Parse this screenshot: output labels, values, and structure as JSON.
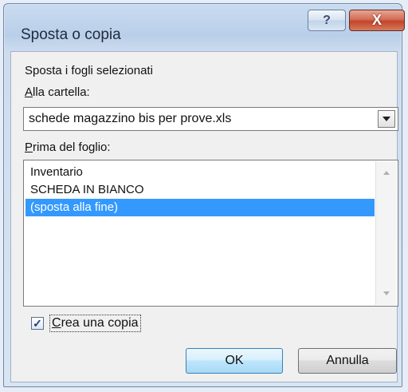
{
  "window": {
    "title": "Sposta o copia",
    "help_label": "?",
    "close_label": "X"
  },
  "dialog": {
    "move_sheets_label": "Sposta i fogli selezionati",
    "to_book_label_accel": "A",
    "to_book_label_rest": "lla cartella:",
    "to_book_value": "schede magazzino bis per prove.xls",
    "before_sheet_label_accel": "P",
    "before_sheet_label_rest": "rima del foglio:",
    "sheets": [
      {
        "label": "Inventario",
        "selected": false
      },
      {
        "label": "SCHEDA IN BIANCO",
        "selected": false
      },
      {
        "label": "(sposta alla fine)",
        "selected": true
      }
    ],
    "create_copy_checked": true,
    "create_copy_label_accel": "C",
    "create_copy_label_rest": "rea una copia",
    "ok_label": "OK",
    "cancel_label": "Annulla"
  }
}
